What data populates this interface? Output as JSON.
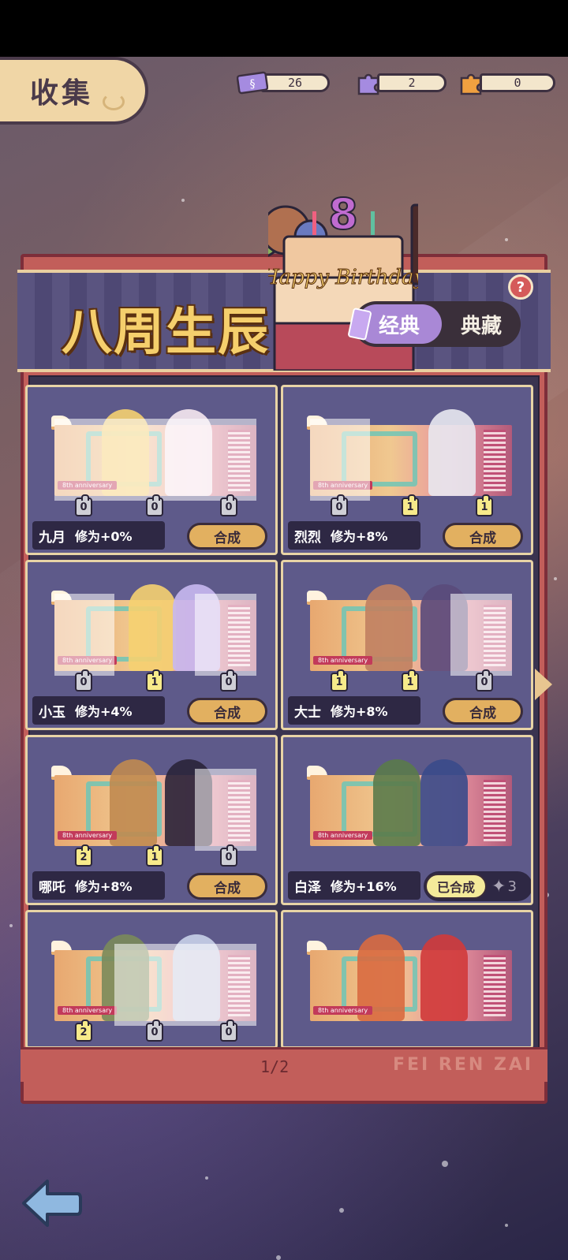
{
  "tab": {
    "label": "收集"
  },
  "resources": [
    {
      "icon": "ticket-icon",
      "value": "26",
      "color": "#a58be0"
    },
    {
      "icon": "purple-puzzle-icon",
      "value": "2",
      "color": "#a58be0"
    },
    {
      "icon": "orange-puzzle-icon",
      "value": "0",
      "color": "#f0a040"
    }
  ],
  "event": {
    "title": "八周生辰",
    "cake_text": "Happy Birthday",
    "cake_number": "8",
    "toggle_active": "经典",
    "toggle_inactive": "典藏",
    "help": "?"
  },
  "cards": [
    {
      "name": "九月",
      "bonus": "修为+0%",
      "counts": [
        "0",
        "0",
        "0"
      ],
      "action": "合成",
      "completed": false
    },
    {
      "name": "烈烈",
      "bonus": "修为+8%",
      "counts": [
        "0",
        "1",
        "1"
      ],
      "action": "合成",
      "completed": false
    },
    {
      "name": "小玉",
      "bonus": "修为+4%",
      "counts": [
        "0",
        "1",
        "0"
      ],
      "action": "合成",
      "completed": false
    },
    {
      "name": "大士",
      "bonus": "修为+8%",
      "counts": [
        "1",
        "1",
        "0"
      ],
      "action": "合成",
      "completed": false
    },
    {
      "name": "哪吒",
      "bonus": "修为+8%",
      "counts": [
        "2",
        "1",
        "0"
      ],
      "action": "合成",
      "completed": false
    },
    {
      "name": "白泽",
      "bonus": "修为+16%",
      "counts": [],
      "action": "已合成",
      "completed": true,
      "pieces": "3"
    },
    {
      "name": "",
      "bonus": "",
      "counts": [
        "2",
        "0",
        "0"
      ],
      "action": "",
      "completed": false
    },
    {
      "name": "",
      "bonus": "",
      "counts": [],
      "action": "",
      "completed": true
    }
  ],
  "card_label": "8th anniversary",
  "pagination": "1/2",
  "brand": "FEI REN ZAI"
}
